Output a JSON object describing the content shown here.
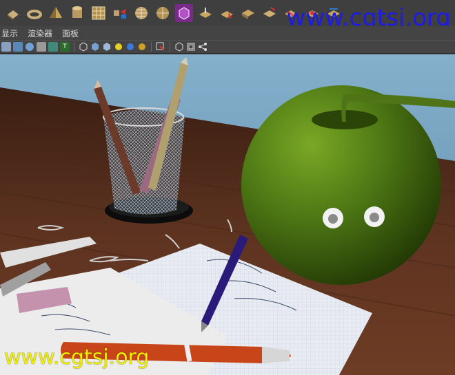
{
  "watermark": {
    "top": "www.cgtsj.org",
    "bottom": "www.cgtsj.org"
  },
  "menu": {
    "items": [
      "显示",
      "渲染器",
      "面板"
    ]
  },
  "shelf": {
    "icons": [
      "shelf-icon-poly-cube",
      "shelf-icon-torus",
      "shelf-icon-pyramid",
      "shelf-icon-cylinder",
      "shelf-icon-plane-grid",
      "shelf-icon-combine",
      "shelf-icon-sphere-grid",
      "shelf-icon-sphere-uv",
      "shelf-icon-cube-magenta",
      "shelf-icon-extrude",
      "shelf-icon-bevel",
      "shelf-icon-select-tool",
      "shelf-icon-bridge",
      "shelf-icon-append",
      "shelf-icon-split",
      "shelf-icon-merge",
      "shelf-icon-uv",
      "shelf-icon-smooth"
    ]
  },
  "toolbar": {
    "icons": [
      "grid-icon",
      "camera-icon",
      "sphere-shade-icon",
      "texture-icon",
      "xray-icon",
      "text-icon",
      "wire-cube-icon",
      "shaded-cube-icon",
      "textured-cube-icon",
      "light-icon",
      "blue-sphere-icon",
      "gold-sphere-icon",
      "select-icon",
      "isolate-cube-icon",
      "frame-icon",
      "share-icon"
    ]
  },
  "colors": {
    "shelf": "#3f3f3f",
    "menubar": "#444444",
    "watermark_top": "#1c1ce6",
    "watermark_bottom": "#f2f200",
    "apple": "#4f7a12",
    "table": "#5a2f1c",
    "background": "#6d98b4"
  }
}
